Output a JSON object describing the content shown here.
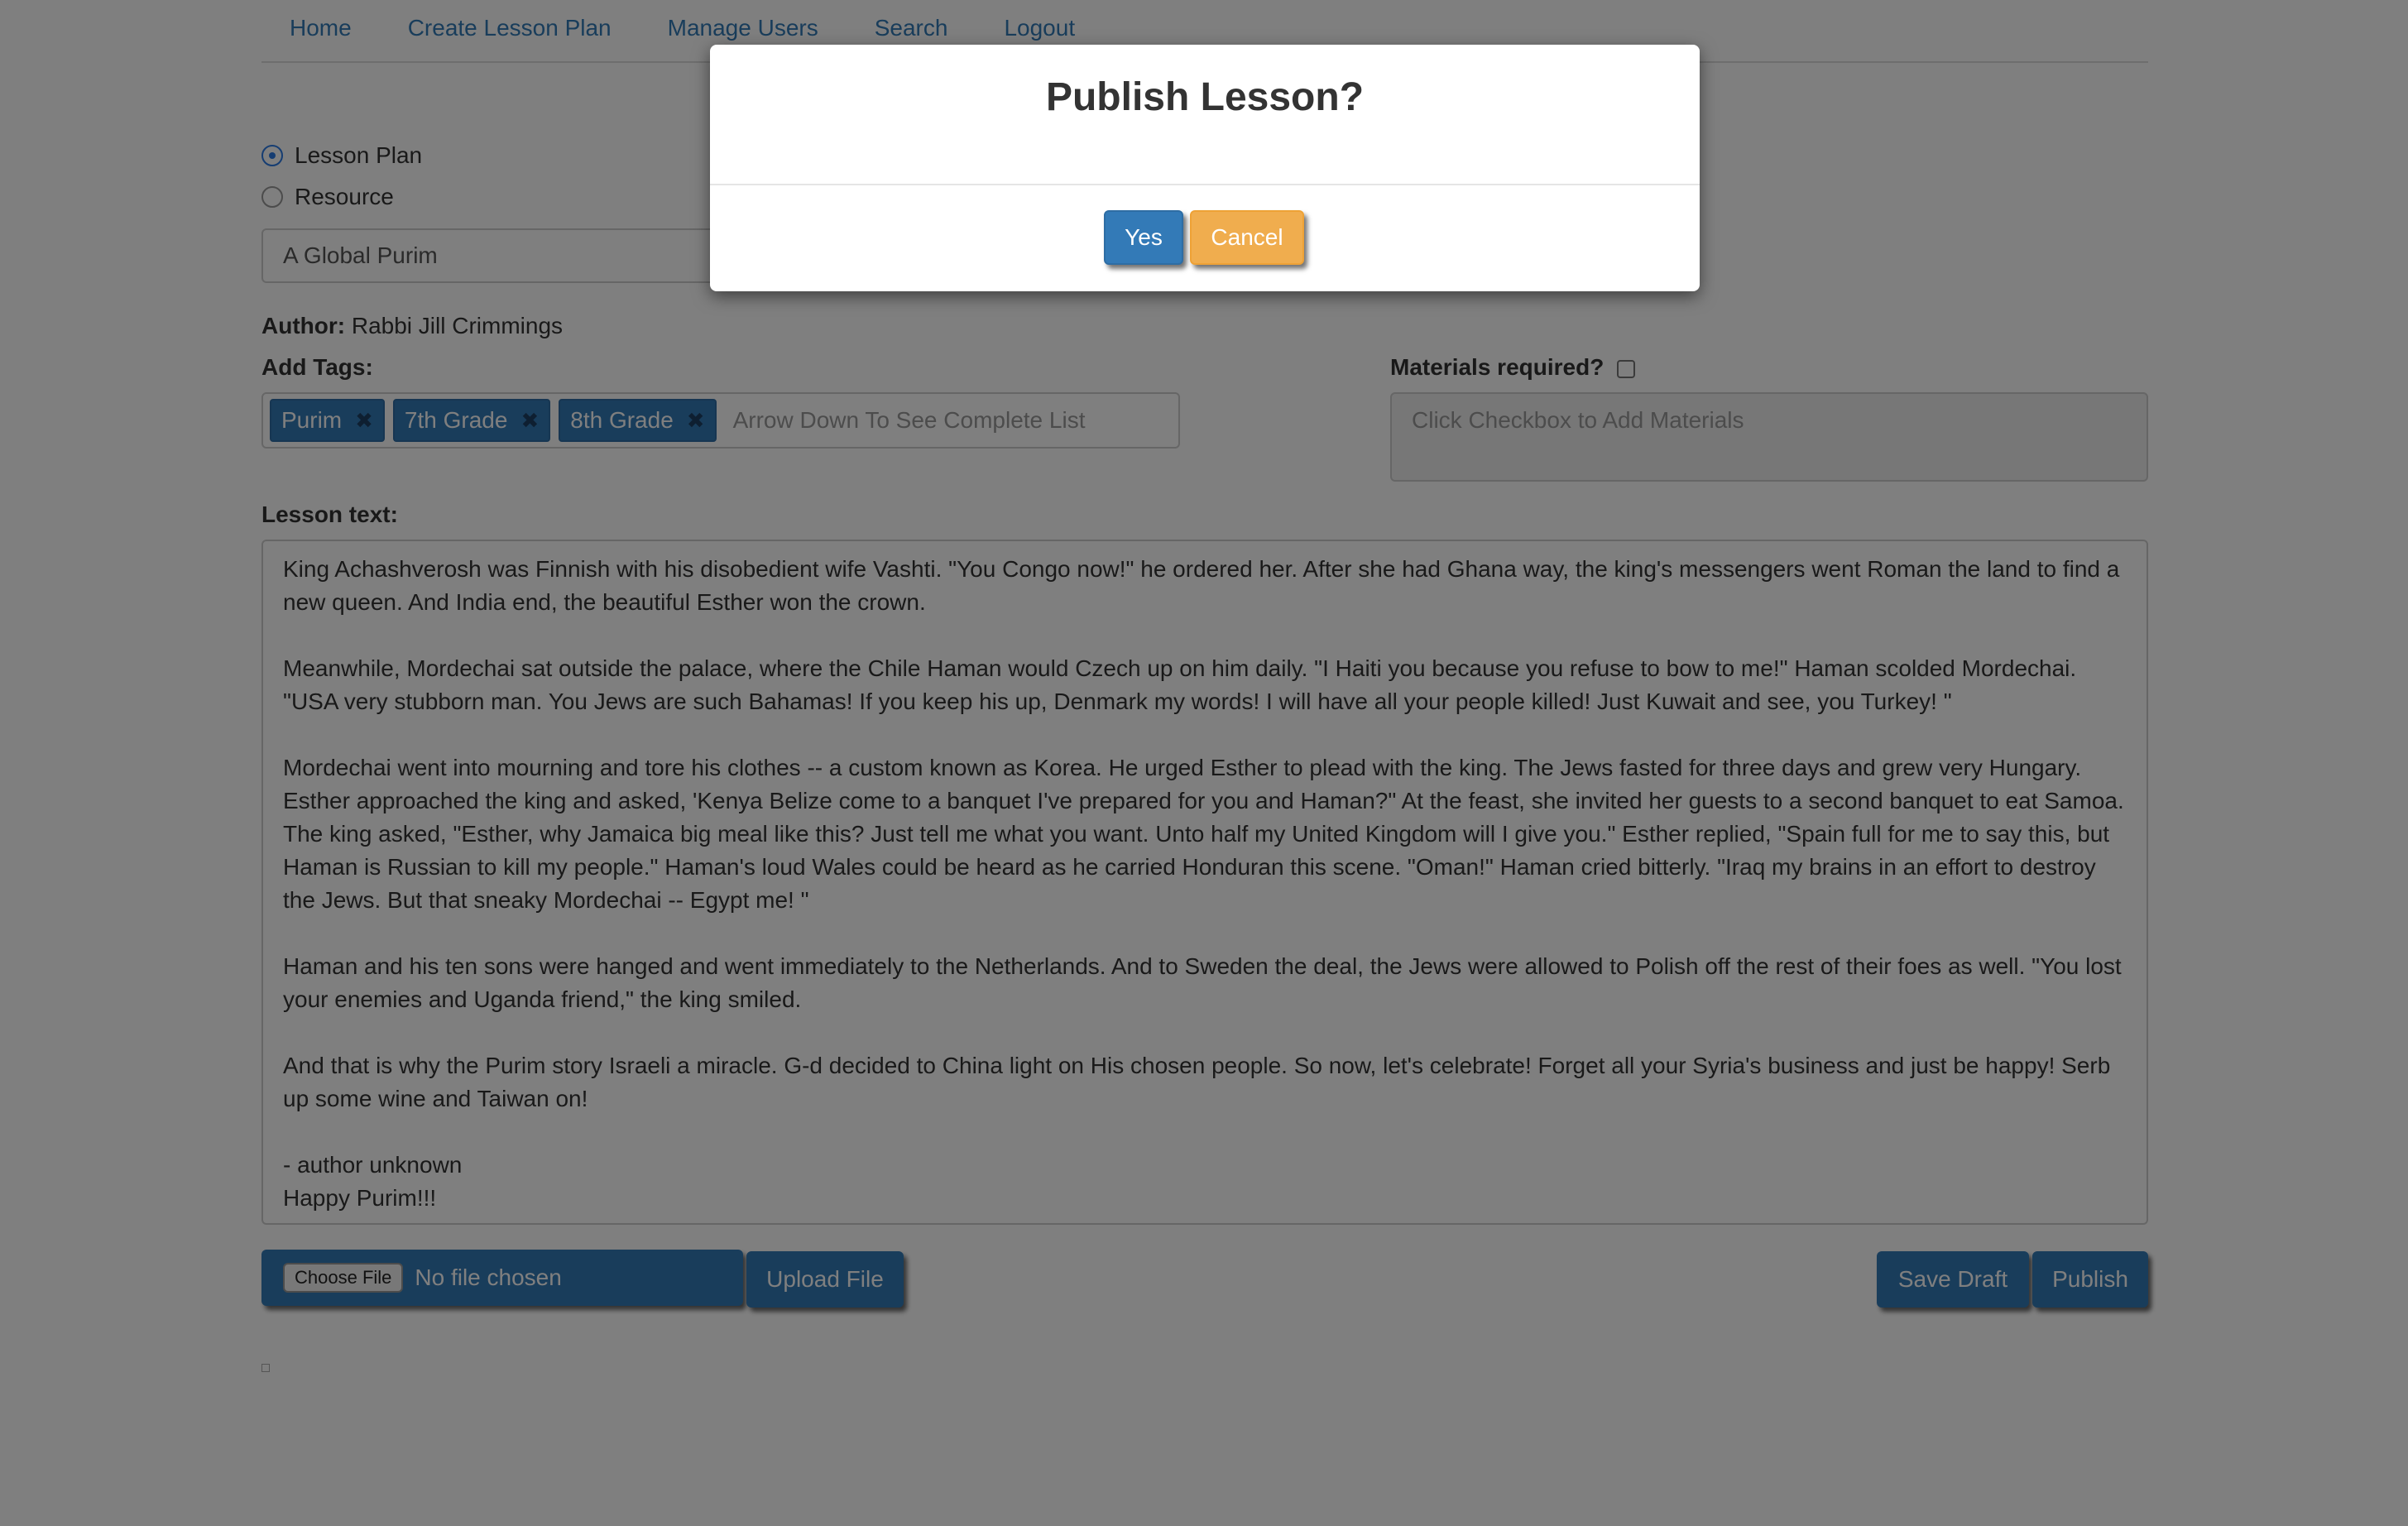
{
  "nav": {
    "items": [
      "Home",
      "Create Lesson Plan",
      "Manage Users",
      "Search",
      "Logout"
    ]
  },
  "form": {
    "type_options": [
      "Lesson Plan",
      "Resource"
    ],
    "selected_type": "Lesson Plan",
    "title_value": "A Global Purim",
    "author_label": "Author:",
    "author_name": "Rabbi Jill Crimmings",
    "tags_label": "Add Tags:",
    "tags": [
      "Purim",
      "7th Grade",
      "8th Grade"
    ],
    "tag_remove_glyph": "✖",
    "tags_placeholder": "Arrow Down To See Complete List",
    "materials_label": "Materials required?",
    "materials_placeholder": "Click Checkbox to Add Materials",
    "lesson_label": "Lesson text:",
    "lesson_paragraphs": [
      "King Achashverosh was Finnish with his disobedient wife Vashti. \"You Congo now!\" he ordered her. After she had Ghana way, the king's messengers went Roman the land to find a new queen. And India end, the beautiful Esther won the crown.",
      "Meanwhile, Mordechai sat outside the palace, where the Chile Haman would Czech up on him daily. \"I Haiti you because you refuse to bow to me!\" Haman scolded Mordechai. \"USA very stubborn man. You Jews are such Bahamas! If you keep his up, Denmark my words! I will have all your people killed! Just Kuwait and see, you Turkey! \"",
      "Mordechai went into mourning and tore his clothes -- a custom known as Korea. He urged Esther to plead with the king. The Jews fasted for three days and grew very Hungary. Esther approached the king and asked, 'Kenya Belize come to a banquet I've prepared for you and Haman?\" At the feast, she invited her guests to a second banquet to eat Samoa. The king asked, \"Esther, why Jamaica big meal like this? Just tell me what you want. Unto half my United Kingdom will I give you.\" Esther replied, \"Spain full for me to say this, but Haman is Russian to kill my people.\" Haman's loud Wales could be heard as he carried Honduran this scene. \"Oman!\" Haman cried bitterly. \"Iraq my brains in an effort to destroy the Jews. But that sneaky Mordechai -- Egypt me! \"",
      "Haman and his ten sons were hanged and went immediately to the Netherlands. And to Sweden the deal, the Jews were allowed to Polish off the rest of their foes as well. \"You lost your enemies and Uganda friend,\" the king smiled.",
      "And that is why the Purim story Israeli a miracle. G-d decided to China light on His chosen people. So now, let's celebrate! Forget all your Syria's business and just be happy! Serb up some wine and Taiwan on!"
    ],
    "lesson_signoff": [
      "- author unknown",
      "Happy Purim!!!"
    ],
    "choose_file_label": "Choose File",
    "no_file_text": "No file chosen",
    "upload_label": "Upload File",
    "save_draft_label": "Save Draft",
    "publish_label": "Publish"
  },
  "modal": {
    "title": "Publish Lesson?",
    "yes_label": "Yes",
    "cancel_label": "Cancel"
  },
  "colors": {
    "primary": "#337ab7",
    "warning": "#f0ad4e",
    "overlay": "rgba(0,0,0,0.5)"
  }
}
